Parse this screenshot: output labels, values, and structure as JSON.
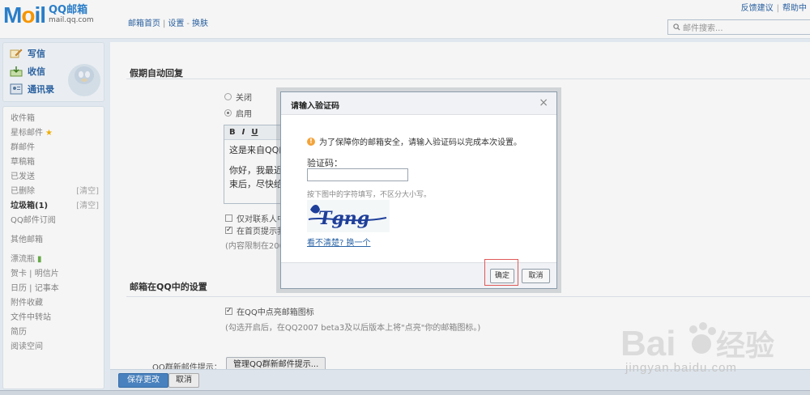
{
  "header": {
    "logo_mark_1": "M",
    "logo_mark_2": "o",
    "logo_mark_3": "il",
    "logo_title": "QQ邮箱",
    "logo_domain": "mail.qq.com",
    "nav_home": "邮箱首页",
    "nav_settings": "设置",
    "nav_skin": "换肤",
    "feedback": "反馈建议",
    "help": "帮助中",
    "search_placeholder": "邮件搜索..."
  },
  "sidebar": {
    "write": "写信",
    "inbox": "收信",
    "contacts": "通讯录",
    "folders": [
      {
        "label": "收件箱"
      },
      {
        "label": "星标邮件"
      },
      {
        "label": "群邮件"
      },
      {
        "label": "草稿箱"
      },
      {
        "label": "已发送"
      },
      {
        "label": "已删除",
        "extra": "[清空]"
      },
      {
        "label": "垃圾箱(1)",
        "extra": "[清空]"
      },
      {
        "label": "QQ邮件订阅"
      }
    ],
    "other_mailbox": "其他邮箱",
    "extras": [
      {
        "label": "漂流瓶"
      },
      {
        "label": "贺卡 | 明信片"
      },
      {
        "label": "日历 | 记事本"
      },
      {
        "label": "附件收藏"
      },
      {
        "label": "文件中转站"
      },
      {
        "label": "简历"
      },
      {
        "label": "阅读空间"
      }
    ]
  },
  "main": {
    "vacation_title": "假期自动回复",
    "radio_off": "关闭",
    "radio_on": "启用",
    "editor_tools": [
      "B",
      "I",
      "U"
    ],
    "editor_line1": "这是来自QQ邮",
    "editor_line2": "你好，我最近",
    "editor_line3": "束后，尽快给",
    "cb_contacts_only": "仅对联系人中",
    "cb_show_home": "在首页提示我",
    "limit_note": "(内容限制在200",
    "qq_section_title": "邮箱在QQ中的设置",
    "qq_cb_label": "在QQ中点亮邮箱图标",
    "qq_note": "(勾选开启后，在QQ2007 beta3及以后版本上将\"点亮\"你的邮箱图标。)",
    "qq_group_label": "QQ群新邮件提示：",
    "qq_group_button": "管理QQ群新邮件提示..."
  },
  "bottom": {
    "save": "保存更改",
    "cancel": "取消"
  },
  "dialog": {
    "title": "请输入验证码",
    "warning": "为了保障你的邮箱安全，请输入验证码以完成本次设置。",
    "code_label": "验证码：",
    "code_value": "",
    "hint": "按下图中的字符填写，不区分大小写。",
    "captcha_text": "Tgng",
    "refresh_link": "看不清楚? 换一个",
    "ok": "确定",
    "cancel": "取消"
  },
  "watermark": {
    "brand": "Bai",
    "brand2": "经验",
    "url": "jingyan.baidu.com"
  },
  "colors": {
    "accent": "#2b64a6",
    "highlight_border": "#e05a5a",
    "save_button": "#4b87c6"
  }
}
